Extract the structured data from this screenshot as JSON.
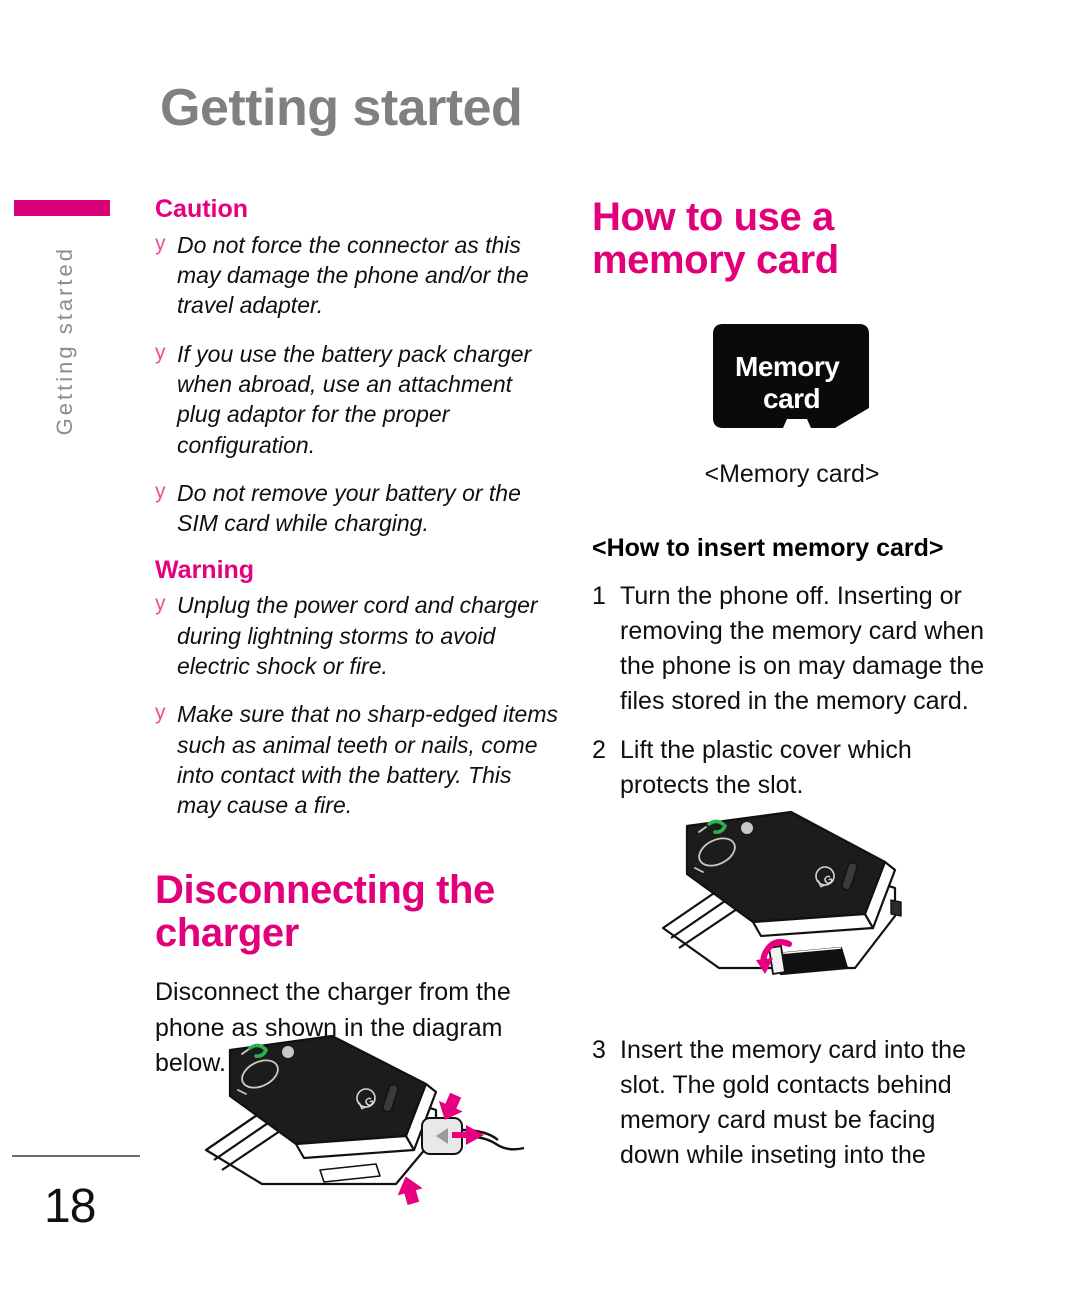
{
  "page": {
    "title": "Getting started",
    "side_tab_label": "Getting started",
    "number": "18"
  },
  "colors": {
    "magenta": "#e6007e",
    "tab_magenta": "#da0078",
    "title_gray": "#808080",
    "body_black": "#0f0f0f"
  },
  "left_column": {
    "caution": {
      "heading": "Caution",
      "bullet_mark": "y",
      "items": [
        "Do not force the connector as this may damage the phone and/or the travel adapter.",
        "If you use the battery pack charger when abroad, use an attachment plug adaptor for the proper configuration.",
        "Do not remove your battery or the SIM card while charging."
      ]
    },
    "warning": {
      "heading": "Warning",
      "bullet_mark": "y",
      "items": [
        "Unplug the power cord and charger during lightning storms to avoid electric shock or fire.",
        "Make sure that no sharp-edged items such as animal teeth or nails, come into contact with the battery. This may cause a fire."
      ]
    },
    "disconnecting": {
      "heading": "Disconnecting the charger",
      "body": "Disconnect the charger from the phone as shown in the diagram below."
    },
    "figure_name": "phone-charger-disconnect-diagram"
  },
  "right_column": {
    "heading": "How to use a memory card",
    "card_art": {
      "line1": "Memory",
      "line2": "card",
      "name": "microsd-memory-card-illustration"
    },
    "caption": "<Memory card>",
    "subheading": "<How to insert memory card>",
    "steps": [
      {
        "num": "1",
        "text": "Turn the phone off. Inserting or removing the memory card when the phone is on may damage the files stored in the memory card."
      },
      {
        "num": "2",
        "text": "Lift the plastic cover which protects the slot."
      },
      {
        "num": "3",
        "text": "Insert the memory card into the slot. The gold contacts behind memory card must be facing down while inseting into the"
      }
    ],
    "figure_name": "phone-memory-card-slot-diagram"
  }
}
